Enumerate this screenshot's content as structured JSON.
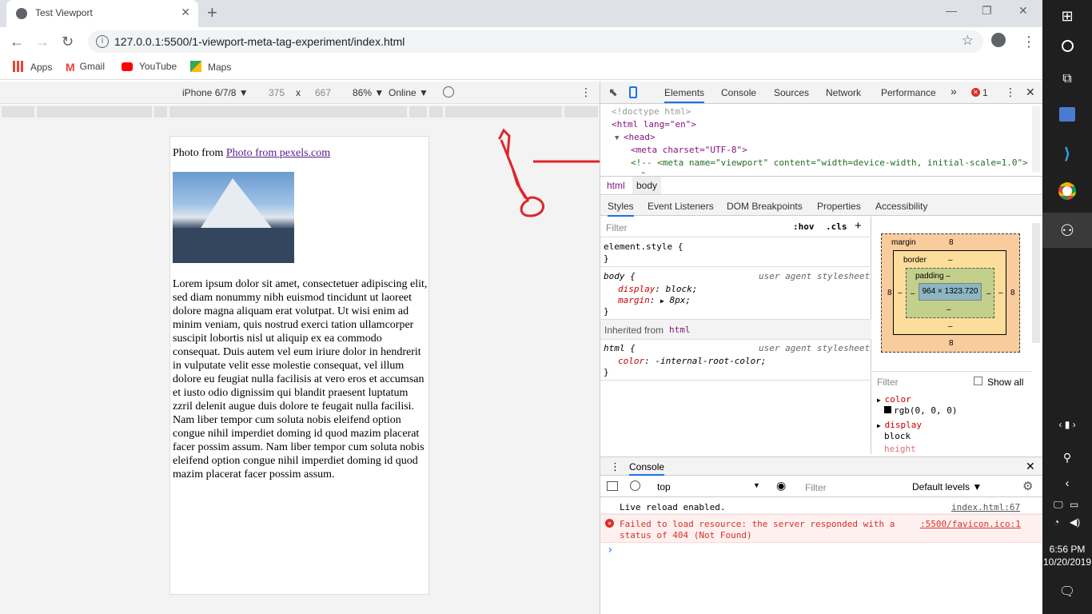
{
  "browser": {
    "tab_title": "Test Viewport",
    "url": "127.0.0.1:5500/1-viewport-meta-tag-experiment/index.html",
    "bookmarks": [
      "Apps",
      "Gmail",
      "YouTube",
      "Maps"
    ]
  },
  "device_toolbar": {
    "device": "iPhone 6/7/8 ▼",
    "width": "375",
    "times": "x",
    "height": "667",
    "zoom": "86% ▼",
    "network": "Online ▼"
  },
  "page": {
    "photo_prefix": "Photo from ",
    "photo_link": "Photo from pexels.com",
    "lorem": "Lorem ipsum dolor sit amet, consectetuer adipiscing elit, sed diam nonummy nibh euismod tincidunt ut laoreet dolore magna aliquam erat volutpat. Ut wisi enim ad minim veniam, quis nostrud exerci tation ullamcorper suscipit lobortis nisl ut aliquip ex ea commodo consequat. Duis autem vel eum iriure dolor in hendrerit in vulputate velit esse molestie consequat, vel illum dolore eu feugiat nulla facilisis at vero eros et accumsan et iusto odio dignissim qui blandit praesent luptatum zzril delenit augue duis dolore te feugait nulla facilisi. Nam liber tempor cum soluta nobis eleifend option congue nihil imperdiet doming id quod mazim placerat facer possim assum. Nam liber tempor cum soluta nobis eleifend option congue nihil imperdiet doming id quod mazim placerat facer possim assum."
  },
  "devtools": {
    "tabs": [
      "Elements",
      "Console",
      "Sources",
      "Network",
      "Performance"
    ],
    "more": "»",
    "error_count": "1",
    "dom": {
      "l1": "<!doctype html>",
      "l2": "<html lang=\"en\">",
      "l3": "<head>",
      "l4": "<meta charset=\"UTF-8\">",
      "l5": "<!-- <meta name=\"viewport\" content=\"width=device-width, initial-scale=1.0\">",
      "l6": "-->"
    },
    "crumbs": [
      "html",
      "body"
    ],
    "subtabs": [
      "Styles",
      "Event Listeners",
      "DOM Breakpoints",
      "Properties",
      "Accessibility"
    ],
    "styles": {
      "filter_placeholder": "Filter",
      "hov": ":hov",
      "cls": ".cls",
      "plus": "+",
      "element_style": "element.style {",
      "close_brace": "}",
      "body_selector": "body {",
      "ua": "user agent stylesheet",
      "display_prop": "display",
      "display_val": "block;",
      "margin_prop": "margin",
      "margin_val": "8px;",
      "inherited_label": "Inherited from ",
      "inherited_tag": "html",
      "html_selector": "html {",
      "color_prop": "color",
      "color_val": "-internal-root-color;"
    },
    "boxmodel": {
      "margin_label": "margin",
      "margin_val": "8",
      "border_label": "border",
      "dash": "–",
      "padding_label": "padding –",
      "content": "964 × 1323.720",
      "side": "8"
    },
    "computed": {
      "filter_placeholder": "Filter",
      "show_all": "Show all",
      "color_prop": "color",
      "color_val": "rgb(0, 0, 0)",
      "display_prop": "display",
      "display_val": "block",
      "height_prop": "height"
    },
    "console": {
      "title": "Console",
      "context": "top",
      "filter_placeholder": "Filter",
      "levels": "Default levels ▼",
      "msg1": "Live reload enabled.",
      "msg1_src": "index.html:67",
      "msg2a": "Failed to load resource: the server responded with a",
      "msg2b": "status of 404 (Not Found)",
      "msg2_src": ":5500/favicon.ico:1",
      "prompt": "›"
    }
  },
  "taskbar": {
    "time": "6:56 PM",
    "date": "10/20/2019"
  },
  "colors": {
    "accent": "#1a73e8",
    "error": "#d93025",
    "annotation": "#e0242b"
  }
}
